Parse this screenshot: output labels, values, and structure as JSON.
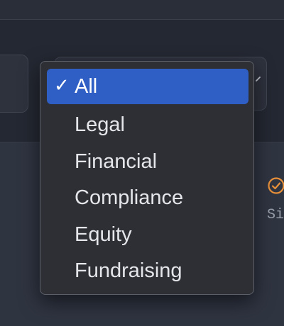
{
  "dropdown": {
    "items": [
      {
        "label": "All",
        "selected": true
      },
      {
        "label": "Legal",
        "selected": false
      },
      {
        "label": "Financial",
        "selected": false
      },
      {
        "label": "Compliance",
        "selected": false
      },
      {
        "label": "Equity",
        "selected": false
      },
      {
        "label": "Fundraising",
        "selected": false
      }
    ]
  },
  "background": {
    "truncated_text": "Si",
    "status_icon": "check-circle-icon"
  },
  "colors": {
    "selection": "#2f5fc4",
    "popup_background": "#2d2f35",
    "status_accent": "#e8913a"
  },
  "icons": {
    "selected_marker": "checkmark-icon",
    "select_chevron": "chevron-icon"
  }
}
